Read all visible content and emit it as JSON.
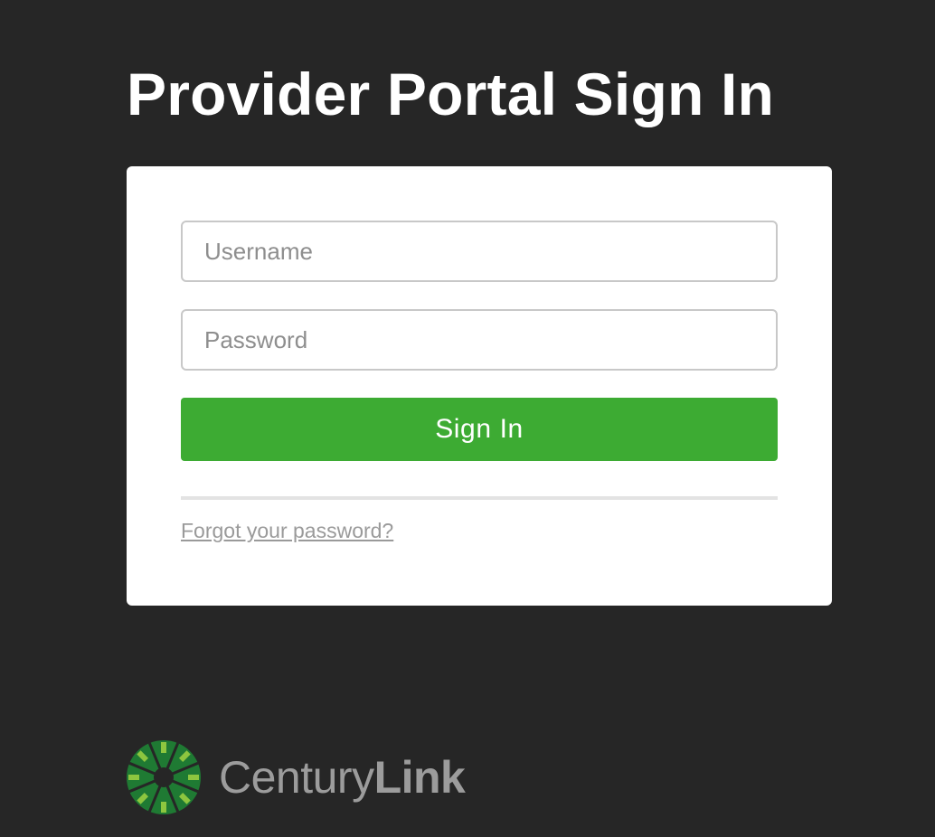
{
  "page": {
    "title": "Provider Portal Sign In"
  },
  "form": {
    "username_placeholder": "Username",
    "username_value": "",
    "password_placeholder": "Password",
    "password_value": "",
    "signin_label": "Sign In",
    "forgot_label": "Forgot your password?"
  },
  "brand": {
    "name_regular": "Century",
    "name_bold": "Link",
    "logo_icon": "centurylink-starburst-logo"
  },
  "colors": {
    "background": "#262626",
    "card": "#ffffff",
    "accent_green": "#3dab33",
    "logo_dark_green": "#1f7a33",
    "logo_light_green": "#8dc63f",
    "muted_text": "#9a9a9a"
  }
}
